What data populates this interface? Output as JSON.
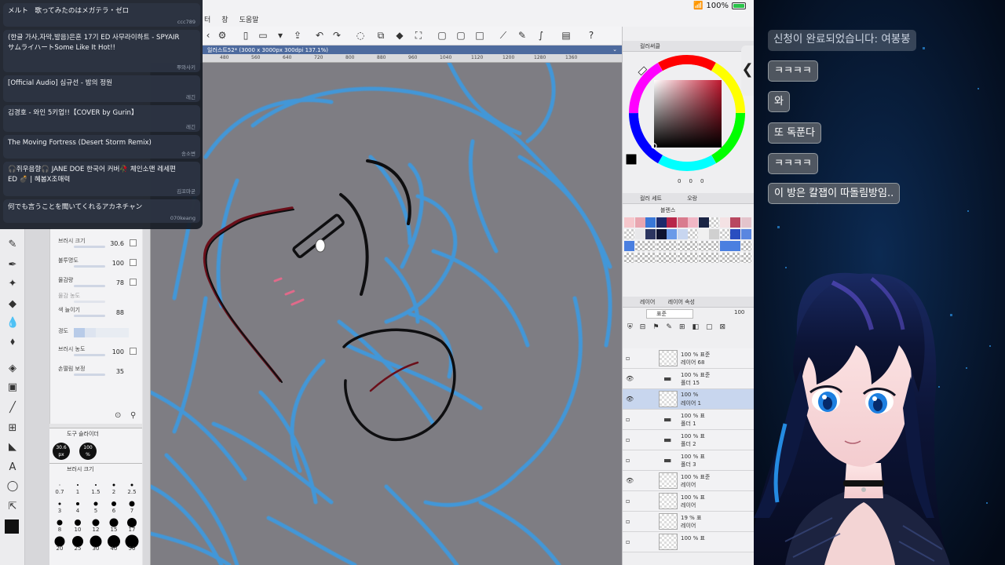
{
  "status": {
    "battery": "100%"
  },
  "menubar": {
    "items": [
      "터",
      "창",
      "도움말"
    ]
  },
  "canvas_tab": {
    "title": "일러스트52* (3000 x 3000px 300dpi 137.1%)"
  },
  "ruler": {
    "ticks": [
      "480",
      "560",
      "640",
      "720",
      "800",
      "880",
      "960",
      "1040",
      "1120",
      "1200",
      "1280",
      "1360"
    ]
  },
  "song_requests": [
    {
      "title": "メルト　歌ってみたのはメガテラ・ゼロ",
      "user": "ccc789"
    },
    {
      "title": "(한글 가사,자막,발음)은혼 17기 ED 사무라이하트 - SPYAIR サムライハートSome Like It Hot!!",
      "user": "뿌와사키"
    },
    {
      "title": "[Official Audio] 심규선 - 밤의 정원",
      "user": "레긴"
    },
    {
      "title": "김경호 - 와인 5키업!!【COVER by Gurin】",
      "user": "레긴"
    },
    {
      "title": "The Moving Fortress (Desert Storm Remix)",
      "user": "송소변"
    },
    {
      "title": "🎧쥐우음향🎧 JANE DOE 한국어 커버🥀 체인소맨 레세편 ED 💣 | 혜봄X조매력",
      "user": "김꼬마굳"
    },
    {
      "title": "何でも言うことを聞いてくれるアカネチャン",
      "user": "070keang"
    }
  ],
  "tool_property": {
    "rows": [
      {
        "label": "브러시 크기",
        "value": "30.6"
      },
      {
        "label": "불투명도",
        "value": "100"
      },
      {
        "label": "물감량",
        "value": "78"
      },
      {
        "label": "물감 농도",
        "value": ""
      },
      {
        "label": "색 늘이기",
        "value": "88"
      },
      {
        "label": "경도",
        "value": ""
      },
      {
        "label": "브러시 농도",
        "value": "100"
      },
      {
        "label": "손떨림 보정",
        "value": "35"
      }
    ]
  },
  "tool_slider": {
    "title": "도구 슬라이더",
    "size": "30.6",
    "size_unit": "px",
    "opacity": "100",
    "opacity_unit": "%"
  },
  "brush_size": {
    "title": "브러시 크기",
    "values": [
      "0.7",
      "1",
      "1.5",
      "2",
      "2.5",
      "3",
      "4",
      "5",
      "6",
      "7",
      "8",
      "10",
      "12",
      "15",
      "17",
      "20",
      "25",
      "30",
      "40",
      "50"
    ]
  },
  "color_wheel": {
    "title": "컬러써클",
    "values": [
      "0",
      "0",
      "0"
    ]
  },
  "color_set": {
    "tabs": [
      "컬러 세트",
      "오랑"
    ],
    "set_name": "블렌스"
  },
  "layer_panel": {
    "tabs": [
      "레이어",
      "레이어 속성"
    ],
    "blend_mode": "표준",
    "opacity": "100",
    "layers": [
      {
        "line1": "100 % 표준",
        "line2": "레이어 68",
        "type": "layer",
        "visible": false,
        "selected": false
      },
      {
        "line1": "100 % 표준",
        "line2": "폴더 15",
        "type": "folder",
        "visible": true,
        "selected": false
      },
      {
        "line1": "100 %",
        "line2": "레이어 1",
        "type": "layer",
        "visible": true,
        "selected": true
      },
      {
        "line1": "100 % 표",
        "line2": "폴더 1",
        "type": "folder",
        "visible": false,
        "selected": false
      },
      {
        "line1": "100 % 표",
        "line2": "폴더 2",
        "type": "folder",
        "visible": false,
        "selected": false
      },
      {
        "line1": "100 % 표",
        "line2": "폴더 3",
        "type": "folder",
        "visible": false,
        "selected": false
      },
      {
        "line1": "100 % 표준",
        "line2": "레이어",
        "type": "layer",
        "visible": true,
        "selected": false
      },
      {
        "line1": "100 % 표",
        "line2": "레이어",
        "type": "layer",
        "visible": false,
        "selected": false
      },
      {
        "line1": "19 % 표",
        "line2": "레이어",
        "type": "layer",
        "visible": false,
        "selected": false
      },
      {
        "line1": "100 % 표",
        "line2": "",
        "type": "layer",
        "visible": false,
        "selected": false
      }
    ]
  },
  "stream_chat": [
    {
      "text": "신청이 완료되었습니다: 여봉봉",
      "style": "light"
    },
    {
      "text": "ㅋㅋㅋㅋ",
      "style": "normal"
    },
    {
      "text": "와",
      "style": "normal"
    },
    {
      "text": "또 독푼다",
      "style": "normal"
    },
    {
      "text": "ㅋㅋㅋㅋ",
      "style": "normal"
    },
    {
      "text": "이 방은 칼잽이 따돌림방임..",
      "style": "normal"
    }
  ],
  "collapse_button": {
    "icon": "chevron-left-icon",
    "glyph": "❮"
  },
  "colors": {
    "tab_blue": "#4d6a9e",
    "sketch_blue": "#3d9ae0",
    "ink": "#0e0e10",
    "heart_red": "#6b0f1a",
    "stream_bg": "#061224"
  }
}
